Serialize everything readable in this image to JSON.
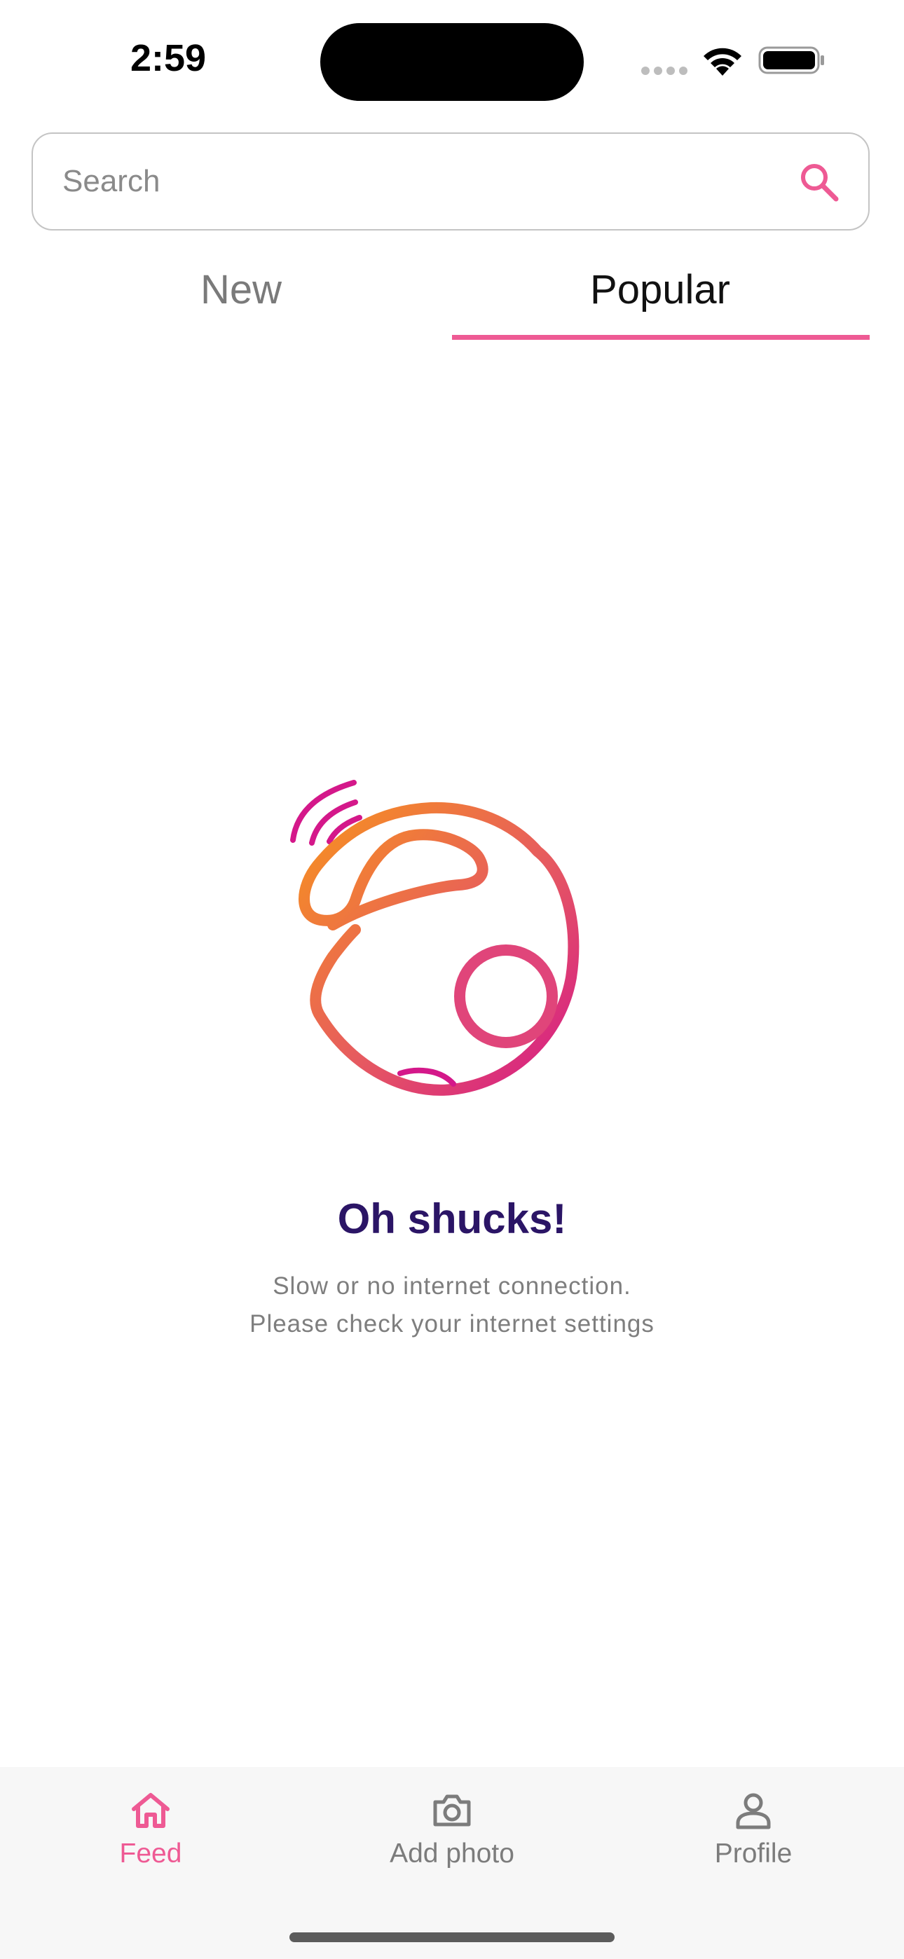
{
  "status_bar": {
    "time": "2:59"
  },
  "search": {
    "placeholder": "Search",
    "value": ""
  },
  "tabs": [
    {
      "label": "New",
      "selected": false
    },
    {
      "label": "Popular",
      "selected": true
    }
  ],
  "empty_state": {
    "title": "Oh shucks!",
    "line1": "Slow or no internet connection.",
    "line2": "Please check your internet settings"
  },
  "bottom_nav": {
    "items": [
      {
        "label": "Feed",
        "icon": "home-icon",
        "active": true
      },
      {
        "label": "Add photo",
        "icon": "camera-icon",
        "active": false
      },
      {
        "label": "Profile",
        "icon": "person-icon",
        "active": false
      }
    ]
  },
  "colors": {
    "accent": "#ee5a94",
    "title": "#2b1566",
    "muted_text": "#7e7e7e",
    "gradient_start": "#f7931e",
    "gradient_end": "#d4188a"
  }
}
